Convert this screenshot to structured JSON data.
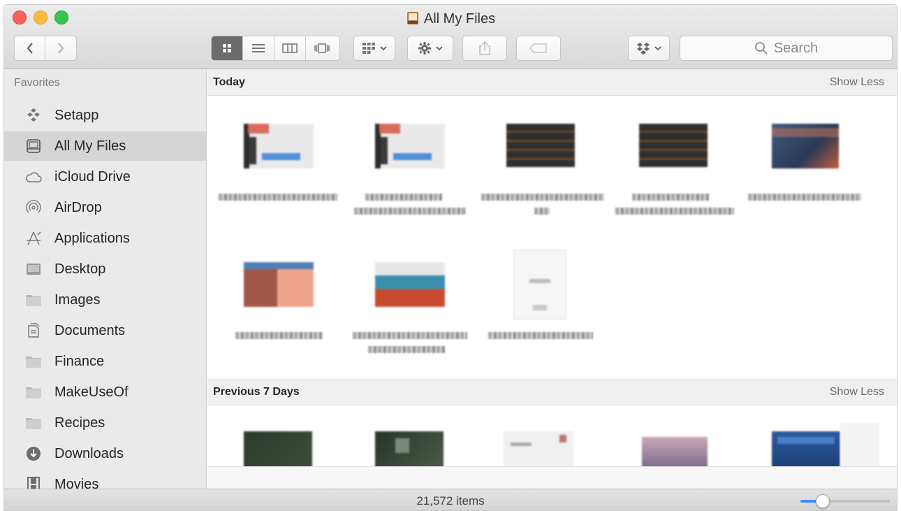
{
  "window": {
    "title": "All My Files"
  },
  "toolbar": {
    "back_icon": "chevron-left-icon",
    "forward_icon": "chevron-right-icon",
    "view_modes": [
      "icon-view",
      "list-view",
      "column-view",
      "cover-flow-view"
    ],
    "active_view": "icon-view",
    "search_placeholder": "Search"
  },
  "sidebar": {
    "heading": "Favorites",
    "selected": "All My Files",
    "items": [
      {
        "label": "Setapp",
        "icon": "setapp-icon"
      },
      {
        "label": "All My Files",
        "icon": "all-files-icon"
      },
      {
        "label": "iCloud Drive",
        "icon": "cloud-icon"
      },
      {
        "label": "AirDrop",
        "icon": "airdrop-icon"
      },
      {
        "label": "Applications",
        "icon": "applications-icon"
      },
      {
        "label": "Desktop",
        "icon": "desktop-icon"
      },
      {
        "label": "Images",
        "icon": "folder-icon"
      },
      {
        "label": "Documents",
        "icon": "documents-icon"
      },
      {
        "label": "Finance",
        "icon": "folder-icon"
      },
      {
        "label": "MakeUseOf",
        "icon": "folder-icon"
      },
      {
        "label": "Recipes",
        "icon": "folder-icon"
      },
      {
        "label": "Downloads",
        "icon": "downloads-icon"
      },
      {
        "label": "Movies",
        "icon": "movies-icon"
      }
    ]
  },
  "sections": [
    {
      "title": "Today",
      "action": "Show Less"
    },
    {
      "title": "Previous 7 Days",
      "action": "Show Less"
    }
  ],
  "status": {
    "item_count": "21,572 items",
    "zoom_level": 0.25
  },
  "colors": {
    "close": "#fc605b",
    "minimize": "#fdbc40",
    "maximize": "#34c84a",
    "slider_accent": "#3a8ef4"
  }
}
